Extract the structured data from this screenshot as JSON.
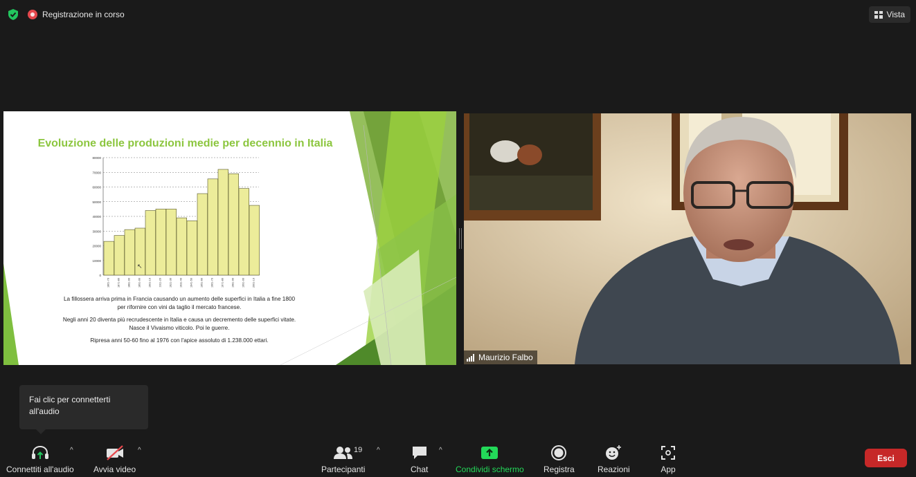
{
  "header": {
    "recording_label": "Registrazione in corso",
    "view_label": "Vista"
  },
  "slide": {
    "title": "Evoluzione delle produzioni medie per decennio in Italia",
    "paragraphs": [
      "La fillossera arriva prima in Francia causando un aumento delle superfici in Italia a fine 1800 per rifornire con vini da taglio il mercato francese.",
      "Negli anni 20 diventa più recrudescente in Italia e causa un decremento delle superfici vitate. Nasce il Vivaismo viticolo. Poi le guerre.",
      "Ripresa anni 50-60 fino al 1976 con l'apice assoluto di 1.238.000 ettari."
    ]
  },
  "chart_data": {
    "type": "bar",
    "title": "Evoluzione delle produzioni medie per decennio in Italia",
    "categories": [
      "1861-70",
      "1871-80",
      "1881-90",
      "1891-00",
      "1901-10",
      "1911-20",
      "1921-30",
      "1931-40",
      "1941-50",
      "1951-60",
      "1961-70",
      "1971-80",
      "1981-90",
      "1991-00",
      "2001-10"
    ],
    "values": [
      23000,
      27000,
      31000,
      32000,
      44000,
      45000,
      45000,
      39000,
      37000,
      55500,
      65500,
      72000,
      69000,
      59000,
      47500
    ],
    "ylim": [
      0,
      80000
    ],
    "yticks": [
      0,
      10000,
      20000,
      30000,
      40000,
      50000,
      60000,
      70000,
      80000
    ],
    "grid": true,
    "colors": {
      "bar": "#ecec9a",
      "bar_edge": "#55552a"
    }
  },
  "video": {
    "participant_name": "Maurizio Falbo"
  },
  "tooltip": {
    "text": "Fai clic per connetterti all'audio"
  },
  "toolbar": {
    "audio_label": "Connettiti all'audio",
    "video_label": "Avvia video",
    "participants_label": "Partecipanti",
    "participants_count": "19",
    "chat_label": "Chat",
    "share_label": "Condividi schermo",
    "record_label": "Registra",
    "reactions_label": "Reazioni",
    "apps_label": "App",
    "leave_label": "Esci"
  },
  "colors": {
    "accent_green": "#22c55e",
    "share_green": "#23d959",
    "leave_red": "#c62828",
    "title_green": "#8cc63f"
  }
}
